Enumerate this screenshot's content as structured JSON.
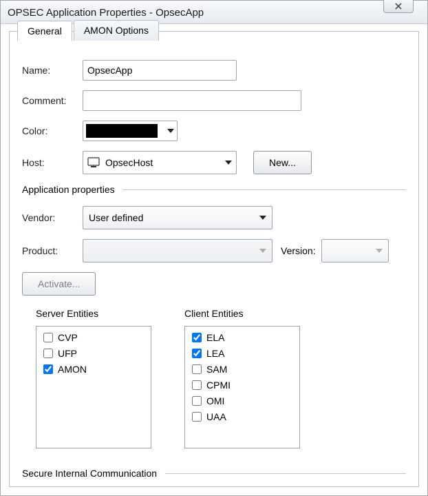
{
  "window": {
    "title": "OPSEC Application Properties - OpsecApp"
  },
  "tabs": {
    "general": "General",
    "amon_options": "AMON Options"
  },
  "form": {
    "name_label": "Name:",
    "name_value": "OpsecApp",
    "comment_label": "Comment:",
    "comment_value": "",
    "color_label": "Color:",
    "color_value": "#000000",
    "host_label": "Host:",
    "host_value": "OpsecHost",
    "new_button": "New..."
  },
  "app_props": {
    "section_title": "Application properties",
    "vendor_label": "Vendor:",
    "vendor_value": "User defined",
    "product_label": "Product:",
    "product_value": "",
    "version_label": "Version:",
    "version_value": "",
    "activate": "Activate..."
  },
  "entities": {
    "server_title": "Server Entities",
    "client_title": "Client Entities",
    "server": {
      "cvp": "CVP",
      "ufp": "UFP",
      "amon": "AMON"
    },
    "client": {
      "ela": "ELA",
      "lea": "LEA",
      "sam": "SAM",
      "cpmi": "CPMI",
      "omi": "OMI",
      "uaa": "UAA"
    }
  },
  "sic": {
    "section_title": "Secure Internal Communication"
  }
}
